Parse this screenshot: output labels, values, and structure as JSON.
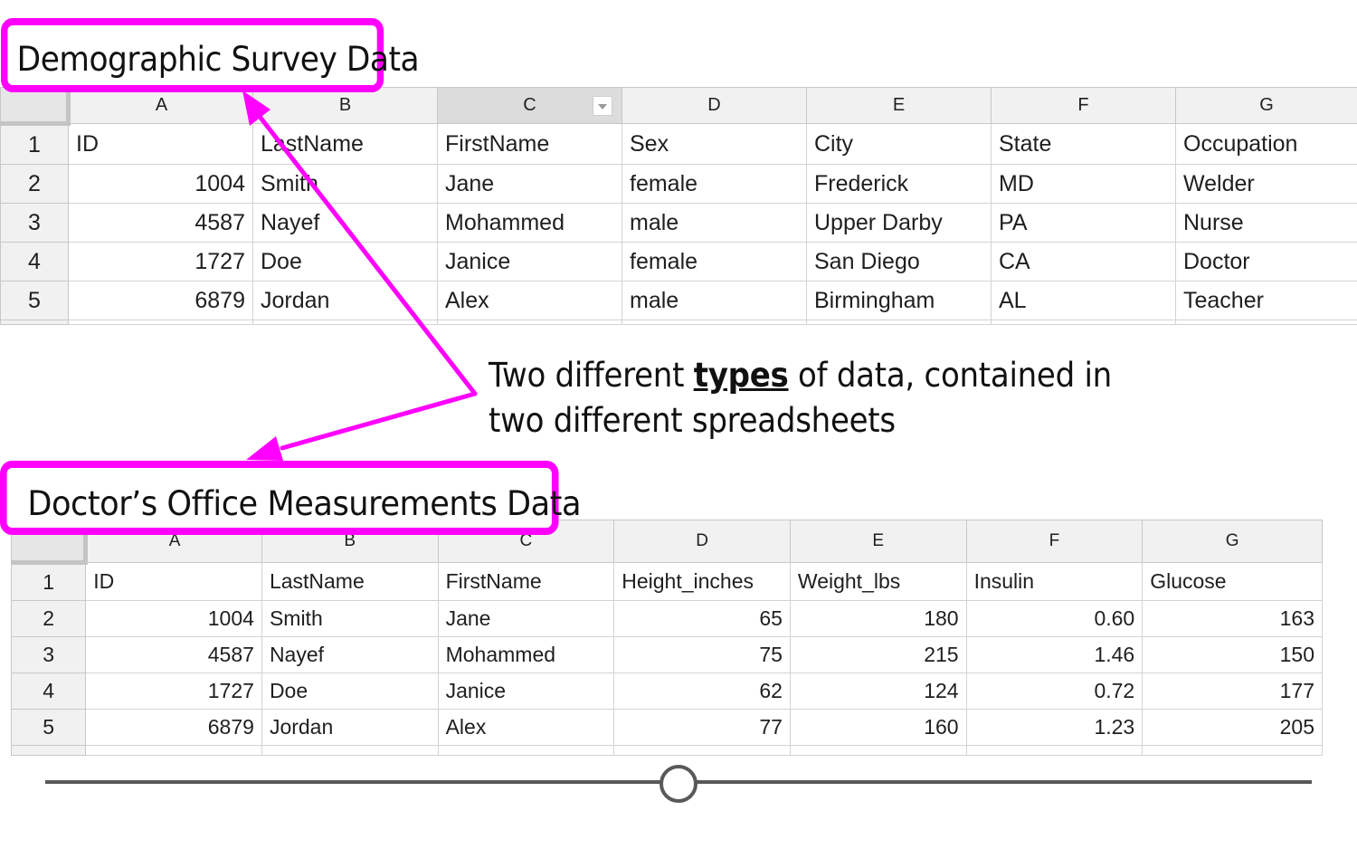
{
  "callouts": {
    "top_label": "Demographic Survey Data",
    "bottom_label": "Doctor’s Office Measurements Data"
  },
  "annotation": {
    "line1_before": "Two different ",
    "line1_emphasis": "types",
    "line1_after": " of data, contained in",
    "line2": "two different spreadsheets"
  },
  "sheet1": {
    "columns": [
      "A",
      "B",
      "C",
      "D",
      "E",
      "F",
      "G"
    ],
    "selected_column": "C",
    "rows": [
      {
        "n": "1",
        "cells": [
          "ID",
          "LastName",
          "FirstName",
          "Sex",
          "City",
          "State",
          "Occupation"
        ]
      },
      {
        "n": "2",
        "cells": [
          "1004",
          "Smith",
          "Jane",
          "female",
          "Frederick",
          "MD",
          "Welder"
        ]
      },
      {
        "n": "3",
        "cells": [
          "4587",
          "Nayef",
          "Mohammed",
          "male",
          "Upper Darby",
          "PA",
          "Nurse"
        ]
      },
      {
        "n": "4",
        "cells": [
          "1727",
          "Doe",
          "Janice",
          "female",
          "San Diego",
          "CA",
          "Doctor"
        ]
      },
      {
        "n": "5",
        "cells": [
          "6879",
          "Jordan",
          "Alex",
          "male",
          "Birmingham",
          "AL",
          "Teacher"
        ]
      }
    ]
  },
  "sheet2": {
    "columns": [
      "A",
      "B",
      "C",
      "D",
      "E",
      "F",
      "G"
    ],
    "rows": [
      {
        "n": "1",
        "cells": [
          "ID",
          "LastName",
          "FirstName",
          "Height_inches",
          "Weight_lbs",
          "Insulin",
          "Glucose"
        ]
      },
      {
        "n": "2",
        "cells": [
          "1004",
          "Smith",
          "Jane",
          "65",
          "180",
          "0.60",
          "163"
        ]
      },
      {
        "n": "3",
        "cells": [
          "4587",
          "Nayef",
          "Mohammed",
          "75",
          "215",
          "1.46",
          "150"
        ]
      },
      {
        "n": "4",
        "cells": [
          "1727",
          "Doe",
          "Janice",
          "62",
          "124",
          "0.72",
          "177"
        ]
      },
      {
        "n": "5",
        "cells": [
          "6879",
          "Jordan",
          "Alex",
          "77",
          "160",
          "1.23",
          "205"
        ]
      }
    ]
  },
  "colors": {
    "highlight": "#ff00ff",
    "grid": "#d3d3d3",
    "header_bg": "#f1f1f1",
    "slider": "#595959"
  },
  "slider": {
    "position_fraction": 0.5
  }
}
